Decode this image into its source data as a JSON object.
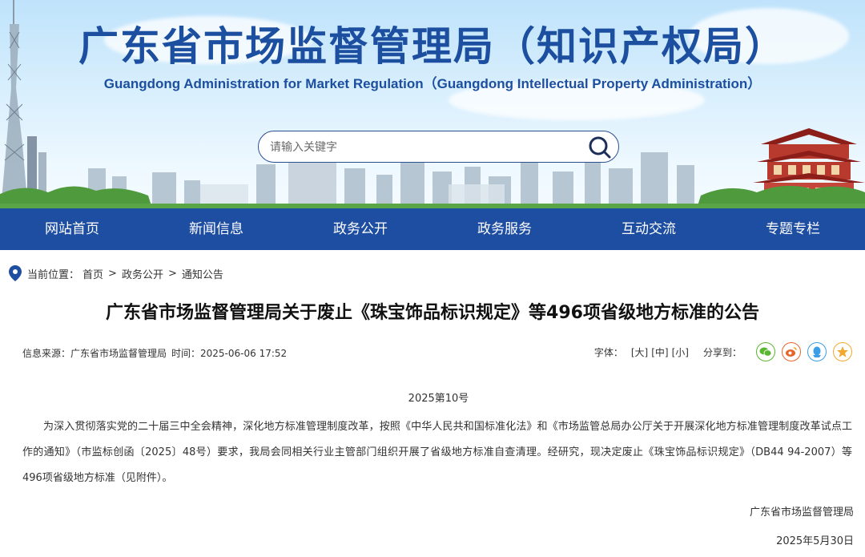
{
  "header": {
    "title_cn": "广东省市场监督管理局（知识产权局）",
    "title_en": "Guangdong Administration for Market Regulation（Guangdong Intellectual Property Administration）",
    "search_placeholder": "请输入关键字"
  },
  "nav": {
    "items": [
      "网站首页",
      "新闻信息",
      "政务公开",
      "政务服务",
      "互动交流",
      "专题专栏"
    ]
  },
  "breadcrumb": {
    "label": "当前位置：",
    "items": [
      "首页",
      "政务公开",
      "通知公告"
    ],
    "separator": ">"
  },
  "article": {
    "title": "广东省市场监督管理局关于废止《珠宝饰品标识规定》等496项省级地方标准的公告",
    "source_label": "信息来源：广东省市场监督管理局",
    "time_label": "时间：2025-06-06 17:52",
    "font_label": "字体：",
    "font_sizes": [
      "[大]",
      "[中]",
      "[小]"
    ],
    "share_label": "分享到：",
    "doc_number": "2025第10号",
    "body": "为深入贯彻落实党的二十届三中全会精神，深化地方标准管理制度改革，按照《中华人民共和国标准化法》和《市场监管总局办公厅关于开展深化地方标准管理制度改革试点工作的通知》（市监标创函〔2025〕48号）要求，我局会同相关行业主管部门组织开展了省级地方标准自查清理。经研究，现决定废止《珠宝饰品标识规定》（DB44 94-2007）等496项省级地方标准（见附件）。",
    "signature": "广东省市场监督管理局",
    "date": "2025年5月30日"
  },
  "colors": {
    "nav_bg": "#1e4ea2",
    "title_blue": "#1d4fa0",
    "wechat": "#5cb531",
    "weibo": "#e6642a",
    "qq": "#3a9ee8",
    "qzone": "#f2a72e"
  },
  "icons": {
    "search": "search-icon",
    "location": "location-pin-icon",
    "share": [
      "wechat-icon",
      "weibo-icon",
      "qq-icon",
      "qzone-icon"
    ]
  }
}
